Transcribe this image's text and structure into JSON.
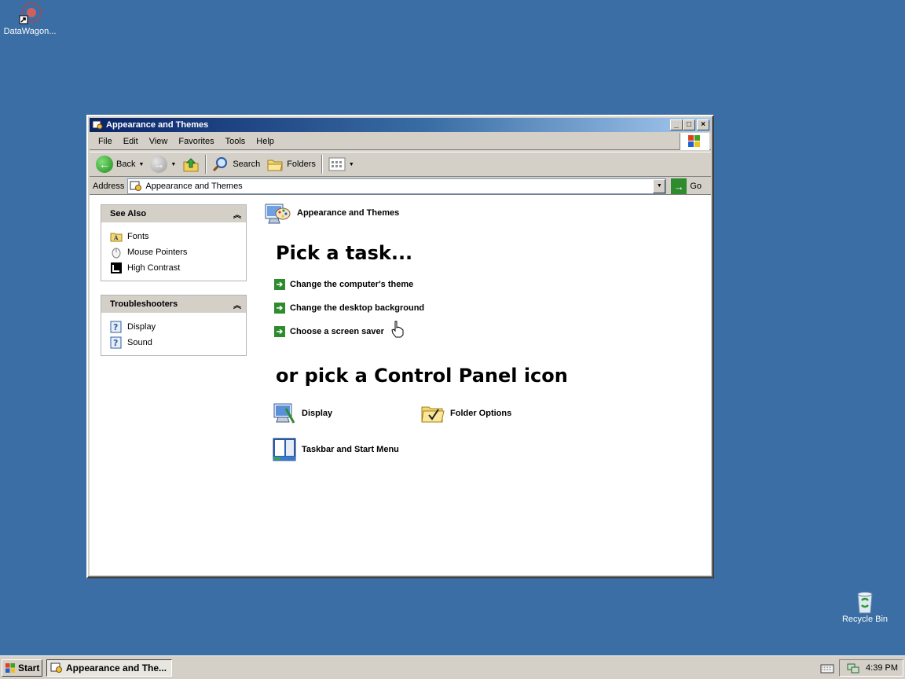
{
  "desktop": {
    "icons": [
      {
        "label": "DataWagon..."
      },
      {
        "label": "Recycle Bin"
      }
    ]
  },
  "window": {
    "title": "Appearance and Themes",
    "buttons": {
      "minimize": "_",
      "maximize": "□",
      "close": "×"
    },
    "menu": [
      "File",
      "Edit",
      "View",
      "Favorites",
      "Tools",
      "Help"
    ],
    "toolbar": {
      "back": "Back",
      "search": "Search",
      "folders": "Folders"
    },
    "address": {
      "label": "Address",
      "value": "Appearance and Themes",
      "go": "Go"
    }
  },
  "sidebar": {
    "see_also": {
      "title": "See Also",
      "items": [
        "Fonts",
        "Mouse Pointers",
        "High Contrast"
      ]
    },
    "troubleshooters": {
      "title": "Troubleshooters",
      "items": [
        "Display",
        "Sound"
      ]
    }
  },
  "main": {
    "category_title": "Appearance and Themes",
    "pick_task": "Pick a task...",
    "tasks": [
      "Change the computer's theme",
      "Change the desktop background",
      "Choose a screen saver"
    ],
    "pick_icon": "or pick a Control Panel icon",
    "icons": [
      "Display",
      "Folder Options",
      "Taskbar and Start Menu"
    ]
  },
  "taskbar": {
    "start": "Start",
    "active_task": "Appearance and The...",
    "clock": "4:39 PM"
  }
}
